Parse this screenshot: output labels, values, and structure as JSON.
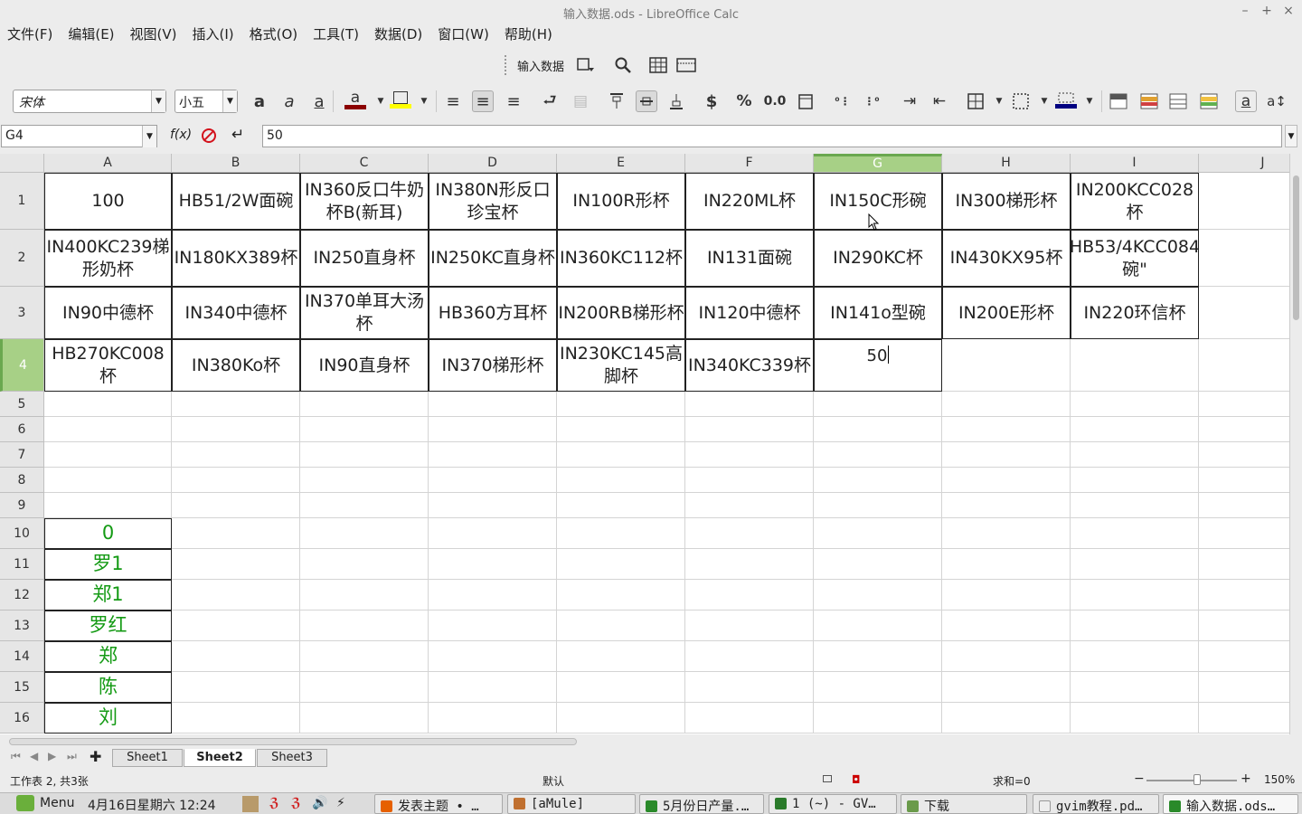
{
  "window": {
    "title": "输入数据.ods - LibreOffice Calc",
    "buttons": [
      "–",
      "+",
      "×"
    ]
  },
  "menu": [
    "文件(F)",
    "编辑(E)",
    "视图(V)",
    "插入(I)",
    "格式(O)",
    "工具(T)",
    "数据(D)",
    "窗口(W)",
    "帮助(H)"
  ],
  "toolbar1": {
    "label": "输入数据"
  },
  "toolbar2": {
    "font_name": "宋体",
    "font_size": "小五",
    "currency": "$",
    "percent": "%",
    "decimal": "0.0"
  },
  "formula": {
    "cell_ref": "G4",
    "fx": "f(x)",
    "value": "50"
  },
  "columns": [
    "A",
    "B",
    "C",
    "D",
    "E",
    "F",
    "G",
    "H",
    "I",
    "J"
  ],
  "active_column": "G",
  "rows": [
    "1",
    "2",
    "3",
    "4",
    "5",
    "6",
    "7",
    "8",
    "9",
    "10",
    "11",
    "12",
    "13",
    "14",
    "15",
    "16"
  ],
  "active_row": "4",
  "table": [
    [
      "100",
      "HB51/2W面碗",
      "IN360反口牛奶杯B(新耳)",
      "IN380N形反口珍宝杯",
      "IN100R形杯",
      "IN220ML杯",
      "IN150C形碗",
      "IN300梯形杯",
      "IN200KCC028杯"
    ],
    [
      "IN400KC239梯形奶杯",
      "IN180KX389杯",
      "IN250直身杯",
      "IN250KC直身杯",
      "IN360KC112杯",
      "IN131面碗",
      "IN290KC杯",
      "IN430KX95杯",
      "HB53/4KCC084碗\""
    ],
    [
      "IN90中德杯",
      "IN340中德杯",
      "IN370单耳大汤杯",
      "HB360方耳杯",
      "IN200RB梯形杯",
      "IN120中德杯",
      "IN141o型碗",
      "IN200E形杯",
      "IN220环信杯"
    ],
    [
      "HB270KC008杯",
      "IN380Ko杯",
      "IN90直身杯",
      "IN370梯形杯",
      "IN230KC145高脚杯",
      "IN340KC339杯",
      "50",
      "",
      ""
    ]
  ],
  "names": [
    "0",
    "罗1",
    "郑1",
    "罗红",
    "郑",
    "陈",
    "刘"
  ],
  "sheets": [
    "Sheet1",
    "Sheet2",
    "Sheet3"
  ],
  "active_sheet": "Sheet2",
  "status": {
    "sheet_info": "工作表 2, 共3张",
    "style": "默认",
    "sum": "求和=0",
    "zoom": "150%"
  },
  "taskbar": {
    "menu": "Menu",
    "datetime": "4月16日星期六 12:24",
    "tasks": [
      "发表主题 • …",
      "[aMule]",
      "5月份日产量.…",
      "1 (~) - GV…",
      "下载",
      "gvim教程.pd…",
      "输入数据.ods…"
    ]
  },
  "colors": {
    "active_header": "#a7d086",
    "name_text": "#139a13"
  }
}
